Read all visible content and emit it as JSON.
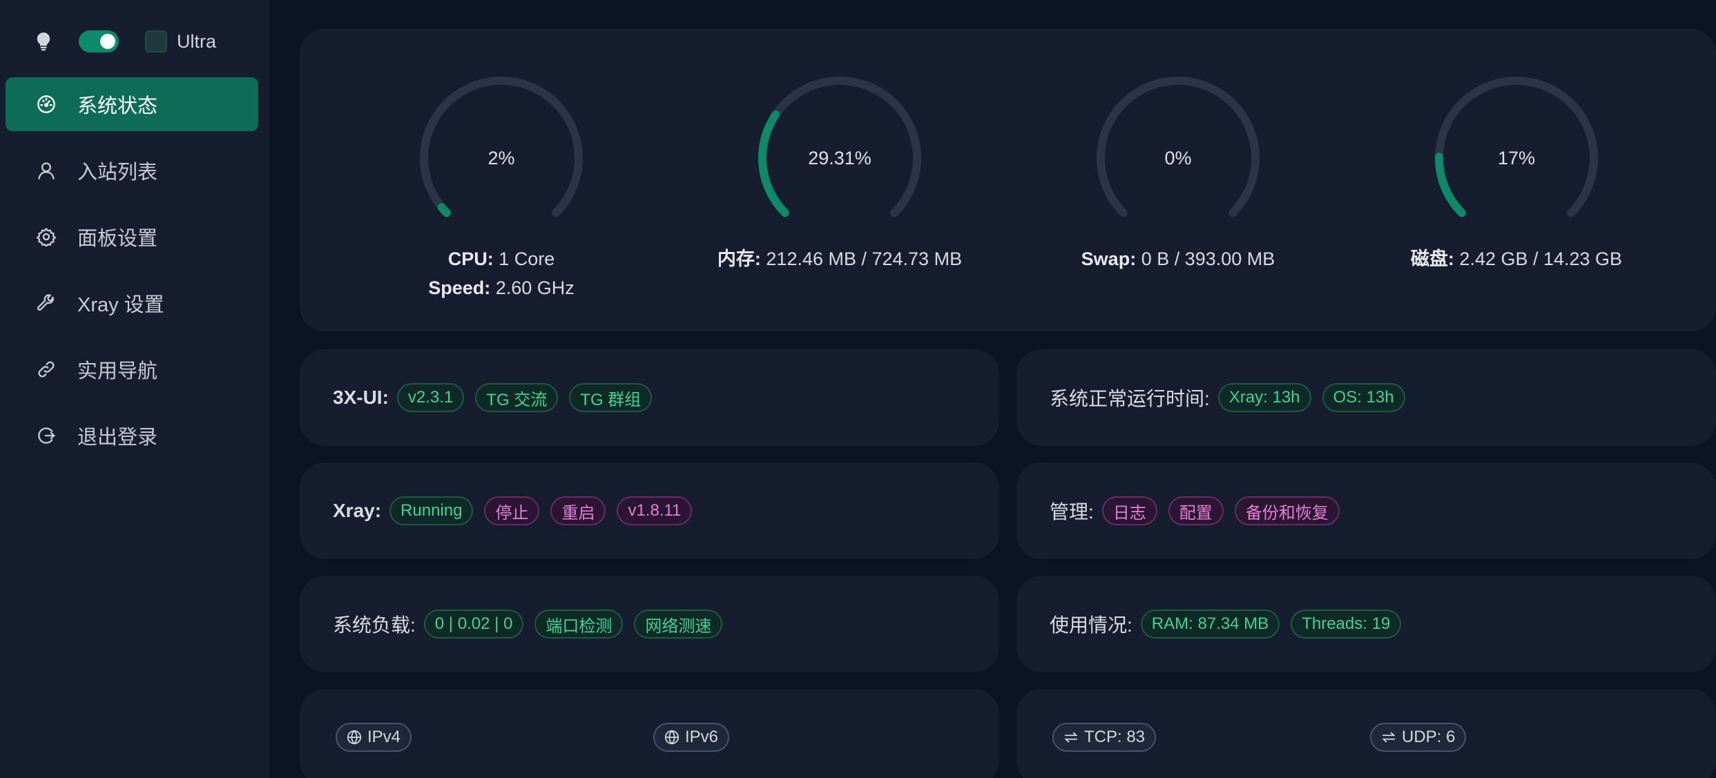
{
  "sidebar": {
    "theme": {
      "ultra_label": "Ultra",
      "dark_mode": true
    },
    "items": [
      {
        "label": "系统状态",
        "icon": "dashboard-icon",
        "active": true
      },
      {
        "label": "入站列表",
        "icon": "user-icon",
        "active": false
      },
      {
        "label": "面板设置",
        "icon": "gear-icon",
        "active": false
      },
      {
        "label": "Xray 设置",
        "icon": "wrench-icon",
        "active": false
      },
      {
        "label": "实用导航",
        "icon": "link-icon",
        "active": false
      },
      {
        "label": "退出登录",
        "icon": "logout-icon",
        "active": false
      }
    ]
  },
  "gauges": [
    {
      "percent": 2,
      "label": "2%",
      "lines": [
        {
          "key": "CPU:",
          "value": " 1 Core"
        },
        {
          "key": "Speed:",
          "value": " 2.60 GHz"
        }
      ]
    },
    {
      "percent": 29.31,
      "label": "29.31%",
      "lines": [
        {
          "key": "内存:",
          "value": " 212.46 MB / 724.73 MB"
        }
      ]
    },
    {
      "percent": 0,
      "label": "0%",
      "lines": [
        {
          "key": "Swap:",
          "value": " 0 B / 393.00 MB"
        }
      ]
    },
    {
      "percent": 17,
      "label": "17%",
      "lines": [
        {
          "key": "磁盘:",
          "value": " 2.42 GB / 14.23 GB"
        }
      ]
    }
  ],
  "panel": {
    "label": "3X-UI:",
    "version": "v2.3.1",
    "tg_chat": "TG 交流",
    "tg_group": "TG 群组"
  },
  "uptime": {
    "label": "系统正常运行时间:",
    "xray": "Xray: 13h",
    "os": "OS: 13h"
  },
  "xray": {
    "label": "Xray:",
    "status": "Running",
    "stop": "停止",
    "restart": "重启",
    "version": "v1.8.11"
  },
  "manage": {
    "label": "管理:",
    "logs": "日志",
    "config": "配置",
    "backup": "备份和恢复"
  },
  "load": {
    "label": "系统负载:",
    "value": "0 | 0.02 | 0",
    "port_check": "端口检测",
    "speed_test": "网络测速"
  },
  "usage": {
    "label": "使用情况:",
    "ram": "RAM: 87.34 MB",
    "threads": "Threads: 19"
  },
  "ip": {
    "ipv4": "IPv4",
    "ipv6": "IPv6"
  },
  "connections": {
    "tcp": "TCP: 83",
    "udp": "UDP: 6"
  },
  "colors": {
    "accent": "#0d8a69",
    "track": "#2c3548",
    "progress": "#0e8a6a"
  }
}
